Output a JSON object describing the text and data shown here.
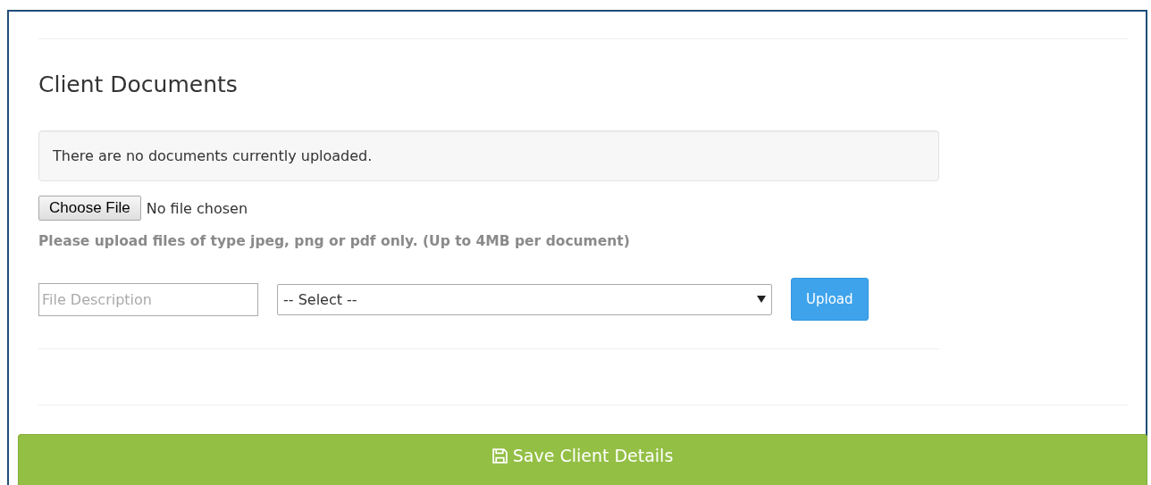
{
  "section": {
    "title": "Client Documents"
  },
  "notice": "There are no documents currently uploaded.",
  "file_input": {
    "button": "Choose File",
    "status": "No file chosen"
  },
  "hint": "Please upload files of type jpeg, png or pdf only. (Up to 4MB per document)",
  "description_field": {
    "placeholder": "File Description"
  },
  "type_select": {
    "value": "-- Select --"
  },
  "upload_button": "Upload",
  "save_button": "Save Client Details"
}
